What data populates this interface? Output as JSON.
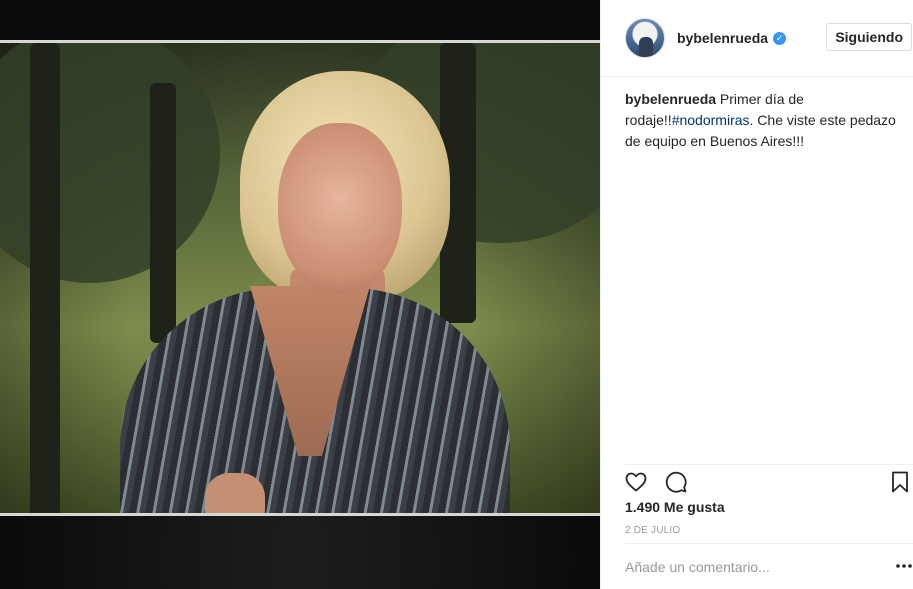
{
  "post": {
    "username": "bybelenrueda",
    "verified_icon": "verified-badge-icon",
    "follow_button_label": "Siguiendo",
    "caption": {
      "user": "bybelenrueda",
      "text_before_tag": " Primer día de rodaje!!",
      "hashtag": "#nodormiras",
      "text_after_tag": ". Che viste este pedazo de equipo en Buenos Aires!!!"
    },
    "actions": {
      "like_icon": "heart-icon",
      "comment_icon": "comment-icon",
      "save_icon": "bookmark-icon"
    },
    "likes_text": "1.490 Me gusta",
    "date_text": "2 DE JULIO",
    "comment": {
      "placeholder": "Añade un comentario...",
      "more_icon": "more-options-icon"
    },
    "colors": {
      "link": "#003569",
      "verified": "#3897f0",
      "muted": "#999999",
      "border": "#efefef"
    }
  }
}
